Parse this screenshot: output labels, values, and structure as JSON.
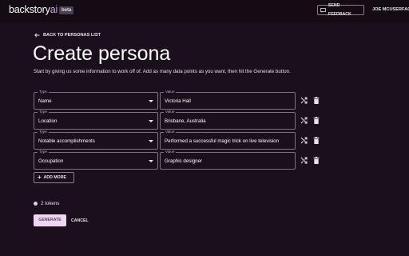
{
  "header": {
    "logo_main": "backstory",
    "logo_accent": "ai",
    "badge": "beta",
    "feedback_label": "SEND FEEDBACK",
    "user_name": "JOE MCUSERFACE"
  },
  "page": {
    "back_label": "BACK TO PERSONAS LIST",
    "title": "Create persona",
    "intro": "Start by giving us some information to work off of. Add as many data points as you want, then hit the Generate button."
  },
  "fields": {
    "type_label": "Type",
    "value_label": "Value",
    "rows": [
      {
        "type": "Name",
        "value": "Victoria Hall"
      },
      {
        "type": "Location",
        "value": "Brisbane, Australia"
      },
      {
        "type": "Notable accomplishments",
        "value": "Performed a successful magic trick on live television"
      },
      {
        "type": "Occupation",
        "value": "Graphic designer"
      }
    ]
  },
  "actions": {
    "add_more_label": "ADD MORE",
    "tokens_label": "2 tokens",
    "generate_label": "GENERATE",
    "cancel_label": "CANCEL"
  },
  "icons": {
    "feedback": "feedback-icon",
    "back": "arrow-left-icon",
    "caret": "caret-down-icon",
    "shuffle": "shuffle-icon",
    "delete": "trash-icon",
    "add": "plus-icon",
    "tokens": "token-dot-icon"
  },
  "colors": {
    "background": "#1c0f1d",
    "topbar": "#140b15",
    "accent": "#c7a5d7",
    "generate_bg": "#f0d6f2"
  }
}
